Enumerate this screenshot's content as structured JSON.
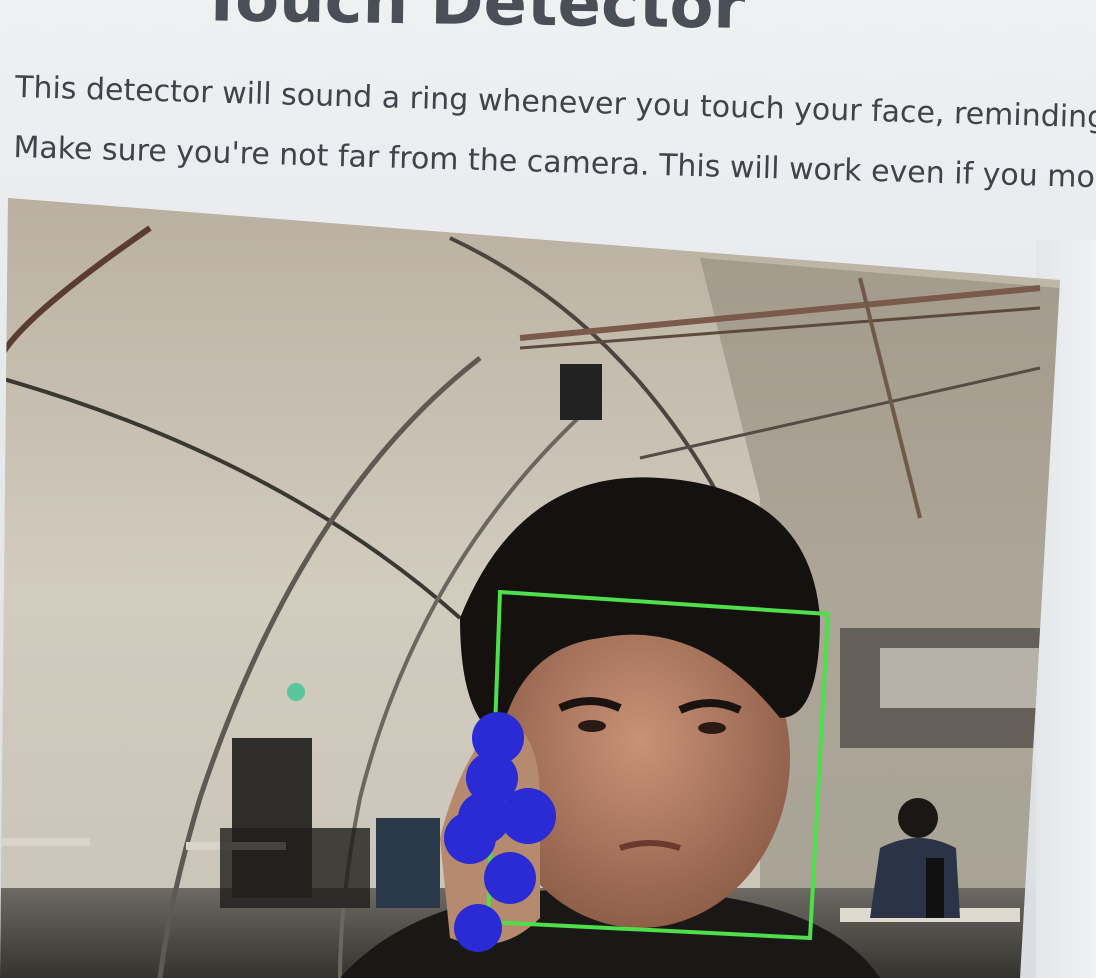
{
  "header": {
    "title": "Touch Detector"
  },
  "description": {
    "line1": "This detector will sound a ring whenever you touch your face, reminding",
    "line2": "Make sure you're not far from the camera. This will work even if you mov"
  },
  "video": {
    "face_box_color": "#4de04a",
    "hand_marker_color": "#2b2bd6",
    "hand_marker_count": 7
  }
}
